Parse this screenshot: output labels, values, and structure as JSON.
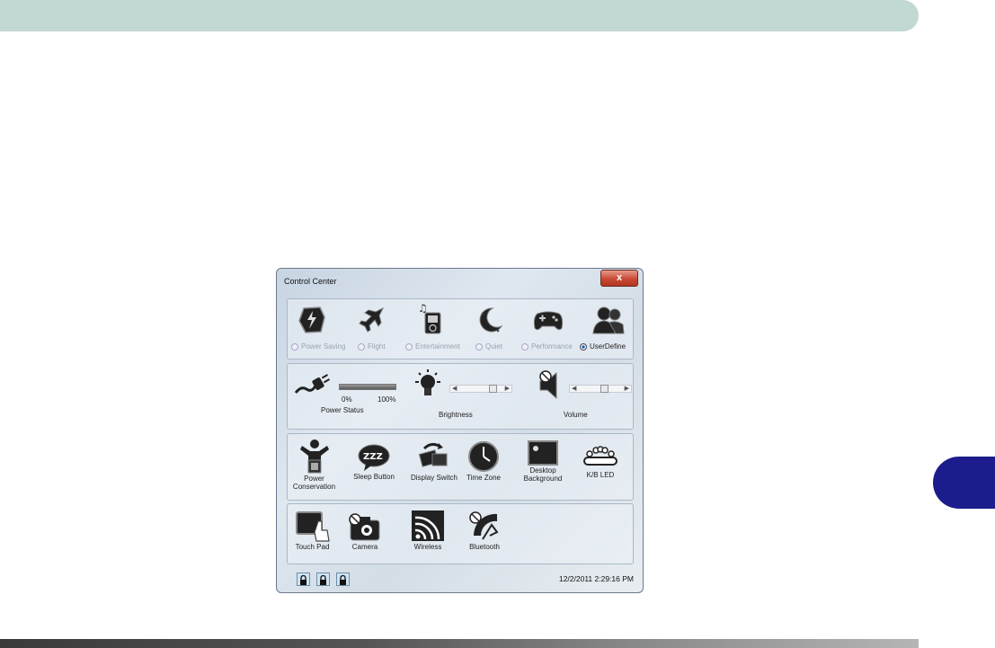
{
  "window": {
    "title": "Control Center",
    "close_label": "x"
  },
  "modes": [
    {
      "label": "Power Saving",
      "icon": "power-saving-icon",
      "selected": false
    },
    {
      "label": "Flight",
      "icon": "airplane-icon",
      "selected": false
    },
    {
      "label": "Entertainment",
      "icon": "music-player-icon",
      "selected": false
    },
    {
      "label": "Quiet",
      "icon": "moon-icon",
      "selected": false
    },
    {
      "label": "Performance",
      "icon": "gamepad-icon",
      "selected": false
    },
    {
      "label": "UserDefine",
      "icon": "users-icon",
      "selected": true
    }
  ],
  "status": {
    "power_status_label": "Power Status",
    "power_min": "0%",
    "power_max": "100%",
    "brightness_label": "Brightness",
    "brightness_level": 0.75,
    "volume_label": "Volume",
    "volume_level": 0.55
  },
  "buttons_row1": [
    {
      "label_line1": "Power",
      "label_line2": "Conservation",
      "icon": "power-conservation-icon"
    },
    {
      "label_line1": "Sleep Button",
      "label_line2": "",
      "icon": "sleep-icon"
    },
    {
      "label_line1": "Display Switch",
      "label_line2": "",
      "icon": "display-switch-icon"
    },
    {
      "label_line1": "Time Zone",
      "label_line2": "",
      "icon": "clock-icon"
    },
    {
      "label_line1": "Desktop",
      "label_line2": "Background",
      "icon": "desktop-background-icon"
    },
    {
      "label_line1": "K/B LED",
      "label_line2": "",
      "icon": "keyboard-led-icon"
    }
  ],
  "buttons_row2": [
    {
      "label": "Touch Pad",
      "icon": "touchpad-icon"
    },
    {
      "label": "Camera",
      "icon": "camera-icon"
    },
    {
      "label": "Wireless",
      "icon": "wireless-icon"
    },
    {
      "label": "Bluetooth",
      "icon": "bluetooth-icon"
    }
  ],
  "statusbar": {
    "datetime": "12/2/2011 2:29:16 PM",
    "locks": [
      "caps-lock-icon",
      "num-lock-icon",
      "scroll-lock-icon"
    ]
  },
  "colors": {
    "chapter_tab": "#1c1c8c",
    "header_bar": "#c2d8d3"
  }
}
